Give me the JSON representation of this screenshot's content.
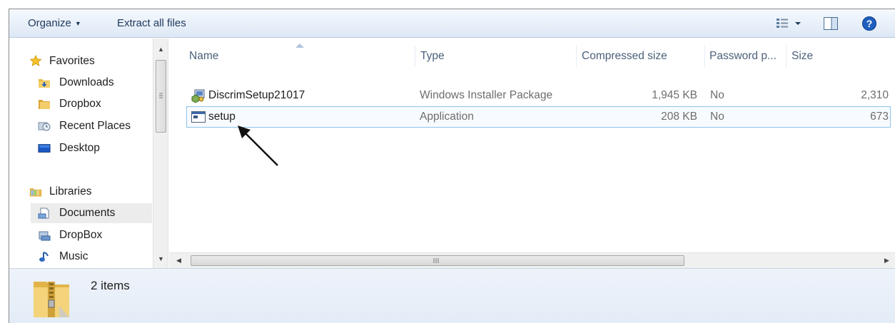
{
  "toolbar": {
    "organize_label": "Organize",
    "extract_label": "Extract all files",
    "view_icon": "details-view-icon",
    "preview_icon": "preview-pane-icon",
    "help_icon": "help-icon"
  },
  "nav": {
    "favorites": {
      "label": "Favorites",
      "icon": "star-icon"
    },
    "favorite_items": [
      {
        "label": "Downloads",
        "icon": "downloads-folder-icon"
      },
      {
        "label": "Dropbox",
        "icon": "folder-icon"
      },
      {
        "label": "Recent Places",
        "icon": "recent-places-icon"
      },
      {
        "label": "Desktop",
        "icon": "desktop-icon"
      }
    ],
    "libraries": {
      "label": "Libraries",
      "icon": "libraries-icon"
    },
    "library_items": [
      {
        "label": "Documents",
        "icon": "documents-library-icon",
        "selected": true
      },
      {
        "label": "DropBox",
        "icon": "library-icon"
      },
      {
        "label": "Music",
        "icon": "music-icon"
      }
    ]
  },
  "columns": {
    "name": "Name",
    "type": "Type",
    "compressed_size": "Compressed size",
    "password": "Password p...",
    "size": "Size"
  },
  "files": [
    {
      "name": "DiscrimSetup21017",
      "type": "Windows Installer Package",
      "compressed": "1,945 KB",
      "password": "No",
      "size": "2,310",
      "icon": "msi-package-icon"
    },
    {
      "name": "setup",
      "type": "Application",
      "compressed": "208 KB",
      "password": "No",
      "size": "673",
      "icon": "application-icon"
    }
  ],
  "details": {
    "count": "2 items",
    "icon": "zip-folder-icon"
  },
  "colors": {
    "toolbar_text": "#1e395b",
    "header_text": "#4c607a",
    "focus_border": "#8ec4ea",
    "help_blue": "#1f5fbf"
  }
}
